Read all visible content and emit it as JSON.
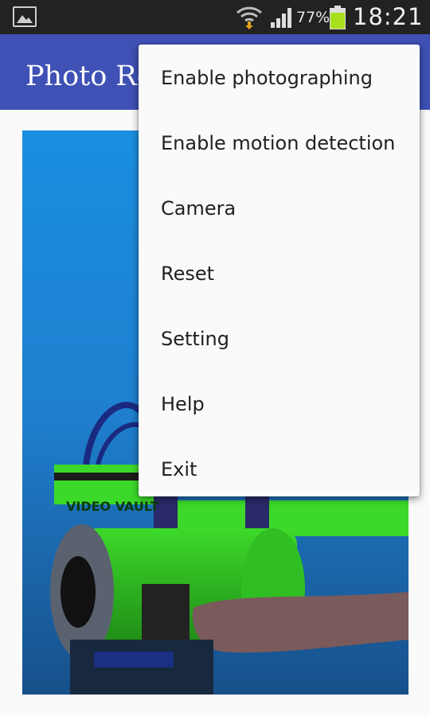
{
  "status_bar": {
    "battery_percent": "77%",
    "time": "18:21",
    "icons": [
      "gallery-notification-icon",
      "wifi-icon",
      "signal-icon",
      "battery-icon"
    ]
  },
  "app_bar": {
    "title": "Photo Re",
    "color": "#3f51b5"
  },
  "photo": {
    "watermark_text": "VIDEO VAULT"
  },
  "menu": {
    "items": [
      {
        "label": "Enable photographing"
      },
      {
        "label": "Enable motion detection"
      },
      {
        "label": "Camera"
      },
      {
        "label": "Reset"
      },
      {
        "label": "Setting"
      },
      {
        "label": "Help"
      },
      {
        "label": "Exit"
      }
    ]
  }
}
